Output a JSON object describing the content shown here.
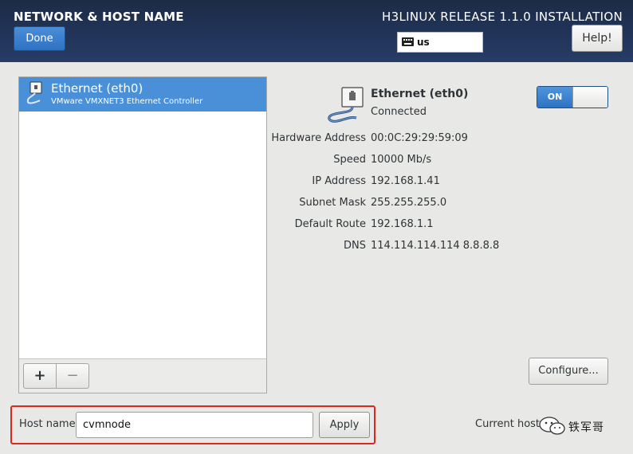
{
  "header": {
    "title": "NETWORK & HOST NAME",
    "done_label": "Done",
    "release": "H3LINUX RELEASE 1.1.0 INSTALLATION",
    "keyboard_layout": "us",
    "help_label": "Help!"
  },
  "device_list": {
    "items": [
      {
        "name": "Ethernet (eth0)",
        "description": "VMware VMXNET3 Ethernet Controller",
        "selected": true
      }
    ],
    "add_label": "+",
    "remove_label": "−"
  },
  "detail": {
    "name": "Ethernet (eth0)",
    "status": "Connected",
    "toggle_label": "ON",
    "toggle_on": true,
    "properties": [
      {
        "label": "Hardware Address",
        "value": "00:0C:29:29:59:09"
      },
      {
        "label": "Speed",
        "value": "10000 Mb/s"
      },
      {
        "label": "IP Address",
        "value": "192.168.1.41"
      },
      {
        "label": "Subnet Mask",
        "value": "255.255.255.0"
      },
      {
        "label": "Default Route",
        "value": "192.168.1.1"
      },
      {
        "label": "DNS",
        "value": "114.114.114.114 8.8.8.8"
      }
    ],
    "configure_label": "Configure..."
  },
  "hostname": {
    "label": "Host name:",
    "value": "cvmnode",
    "apply_label": "Apply",
    "current_label": "Current host"
  },
  "watermark": {
    "text": "铁军哥"
  },
  "colors": {
    "header": "#22355a",
    "accent": "#4a90d9",
    "highlight_border": "#e0261d"
  }
}
